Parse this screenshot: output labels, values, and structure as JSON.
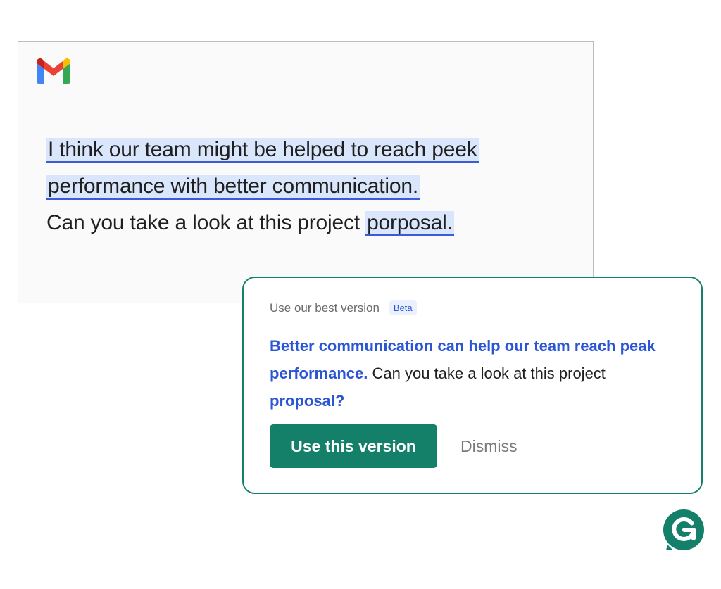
{
  "email": {
    "app_icon": "gmail-logo-icon",
    "line1": "I think our team might be helped to reach peek",
    "line2": "performance with better communication.",
    "line3_plain": "Can you take a look at this project ",
    "line3_highlight": "porposal."
  },
  "suggestion": {
    "heading": "Use our best version",
    "badge": "Beta",
    "part1_strong": "Better communication can help our team reach peak performance.",
    "part2_plain": " Can you take a look at this project ",
    "part3_strong": "proposal?",
    "use_button": "Use this version",
    "dismiss_button": "Dismiss"
  },
  "brand": {
    "logo_icon": "grammarly-logo-icon"
  },
  "colors": {
    "accent_green": "#15806a",
    "suggest_blue": "#2a55d4",
    "highlight_bg": "#d9e6fb",
    "underline_blue": "#3b5bdb",
    "gmail_red": "#ea4335",
    "gmail_blue": "#4285f4",
    "gmail_green": "#34a853",
    "gmail_yellow": "#fbbc04"
  }
}
